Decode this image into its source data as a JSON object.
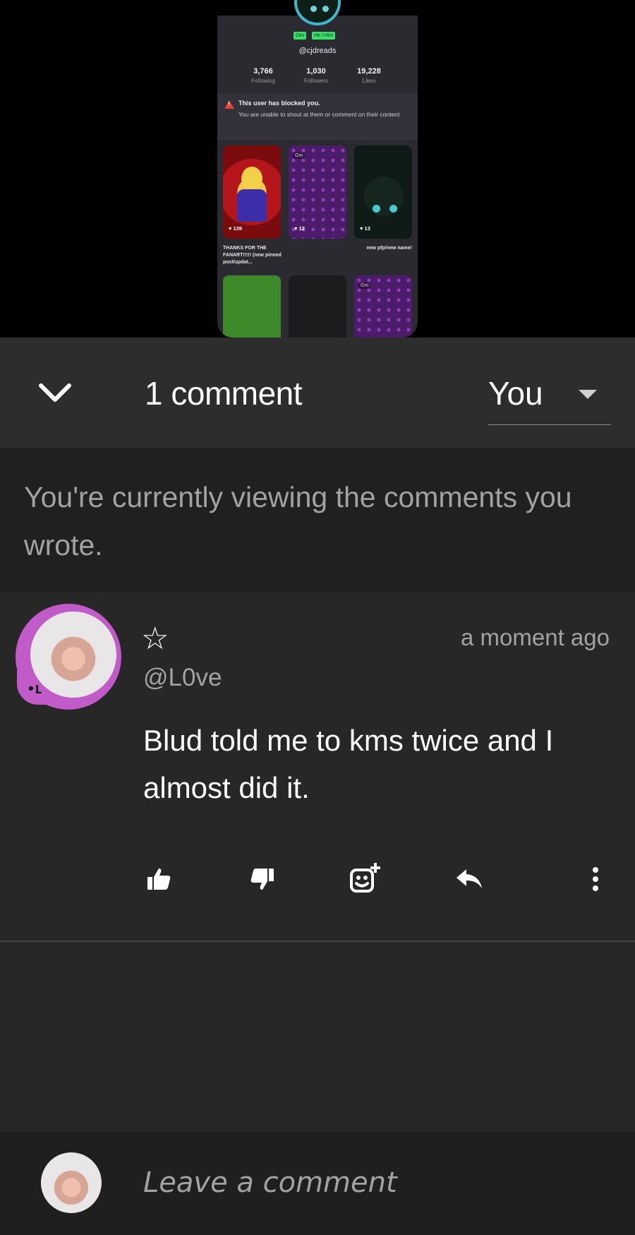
{
  "profile_preview": {
    "tags": [
      "Dev",
      "He / Him"
    ],
    "handle": "@cjdreads",
    "stats": [
      {
        "value": "3,766",
        "label": "Following"
      },
      {
        "value": "1,030",
        "label": "Followers"
      },
      {
        "value": "19,228",
        "label": "Likes"
      }
    ],
    "blocked_title": "This user has blocked you.",
    "blocked_body": "You are unable to shout at them or comment on their content",
    "posts": [
      {
        "likes": "139",
        "caption": "THANKS FOR THE FANART!!!!! (new pinned post/updat..."
      },
      {
        "label": "Gm",
        "likes": "12"
      },
      {
        "likes": "13",
        "caption": "new pfp/new name!"
      },
      {},
      {},
      {
        "label": "Gm"
      }
    ]
  },
  "header": {
    "count_label": "1 comment",
    "filter_value": "You"
  },
  "notice": "You're currently viewing the comments you wrote.",
  "comment": {
    "badge_glyph": "☆",
    "time": "a moment ago",
    "author": "@L0ve",
    "text": "Blud told me to kms twice and I almost did it.",
    "actions": [
      "like-icon",
      "dislike-icon",
      "add-reaction-icon",
      "reply-icon",
      "more-options-icon"
    ]
  },
  "composer": {
    "placeholder": "Leave a comment"
  },
  "colors": {
    "header_bg": "#2d2d2d",
    "notice_bg": "#202020",
    "comment_bg": "#272727",
    "avatar_frame": "#c05bc7",
    "muted_text": "#a2a2a2"
  }
}
